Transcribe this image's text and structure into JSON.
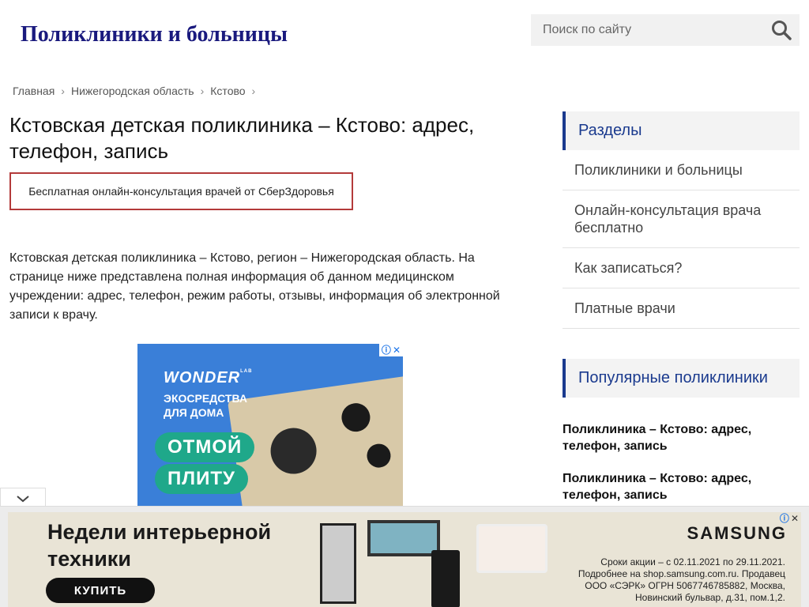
{
  "header": {
    "site_title": "Поликлиники и больницы",
    "search_placeholder": "Поиск по сайту"
  },
  "breadcrumb": [
    {
      "label": "Главная"
    },
    {
      "label": "Нижегородская область"
    },
    {
      "label": "Кстово"
    }
  ],
  "breadcrumb_sep": "›",
  "main": {
    "title": "Кстовская детская поликлиника – Кстово: адрес, телефон, запись",
    "consult_button": "Бесплатная онлайн-консультация врачей от СберЗдоровья",
    "intro": "Кстовская детская поликлиника – Кстово, регион – Нижегородская область. На странице ниже представлена полная информация об данном медицинском учреждении: адрес, телефон, режим работы, отзывы, информация об электронной записи к врачу."
  },
  "ad_center": {
    "brand": "WONDER",
    "brand_sup": "LAB",
    "tagline": "ЭКОСРЕДСТВА ДЛЯ ДОМА",
    "pill1": "ОТМОЙ",
    "pill2": "ПЛИТУ",
    "info_icon": "ⓘ",
    "close_icon": "✕"
  },
  "sidebar": {
    "sections_title": "Разделы",
    "items": [
      {
        "label": "Поликлиники и больницы"
      },
      {
        "label": "Онлайн-консультация врача бесплатно"
      },
      {
        "label": "Как записаться?"
      },
      {
        "label": "Платные врачи"
      }
    ],
    "popular_title": "Популярные поликлиники",
    "popular": [
      {
        "label": "Поликлиника – Кстово: адрес, телефон, запись"
      },
      {
        "label": "Поликлиника – Кстово: адрес, телефон, запись"
      }
    ]
  },
  "bottom_ad": {
    "headline": "Недели интерьерной техники",
    "buy_label": "КУПИТЬ",
    "brand": "SAMSUNG",
    "legal": "Сроки акции – с 02.11.2021 по 29.11.2021. Подробнее на shop.samsung.com.ru. Продавец ООО «СЭРК» ОГРН 5067746785882, Москва, Новинский бульвар, д.31, пом.1,2."
  },
  "colors": {
    "brand_title": "#1a1a7e",
    "sidebar_accent": "#1a3a8e",
    "consult_border": "#b33a3a",
    "ad_blue": "#3a7fd8",
    "pill_green": "#1fa88a"
  }
}
